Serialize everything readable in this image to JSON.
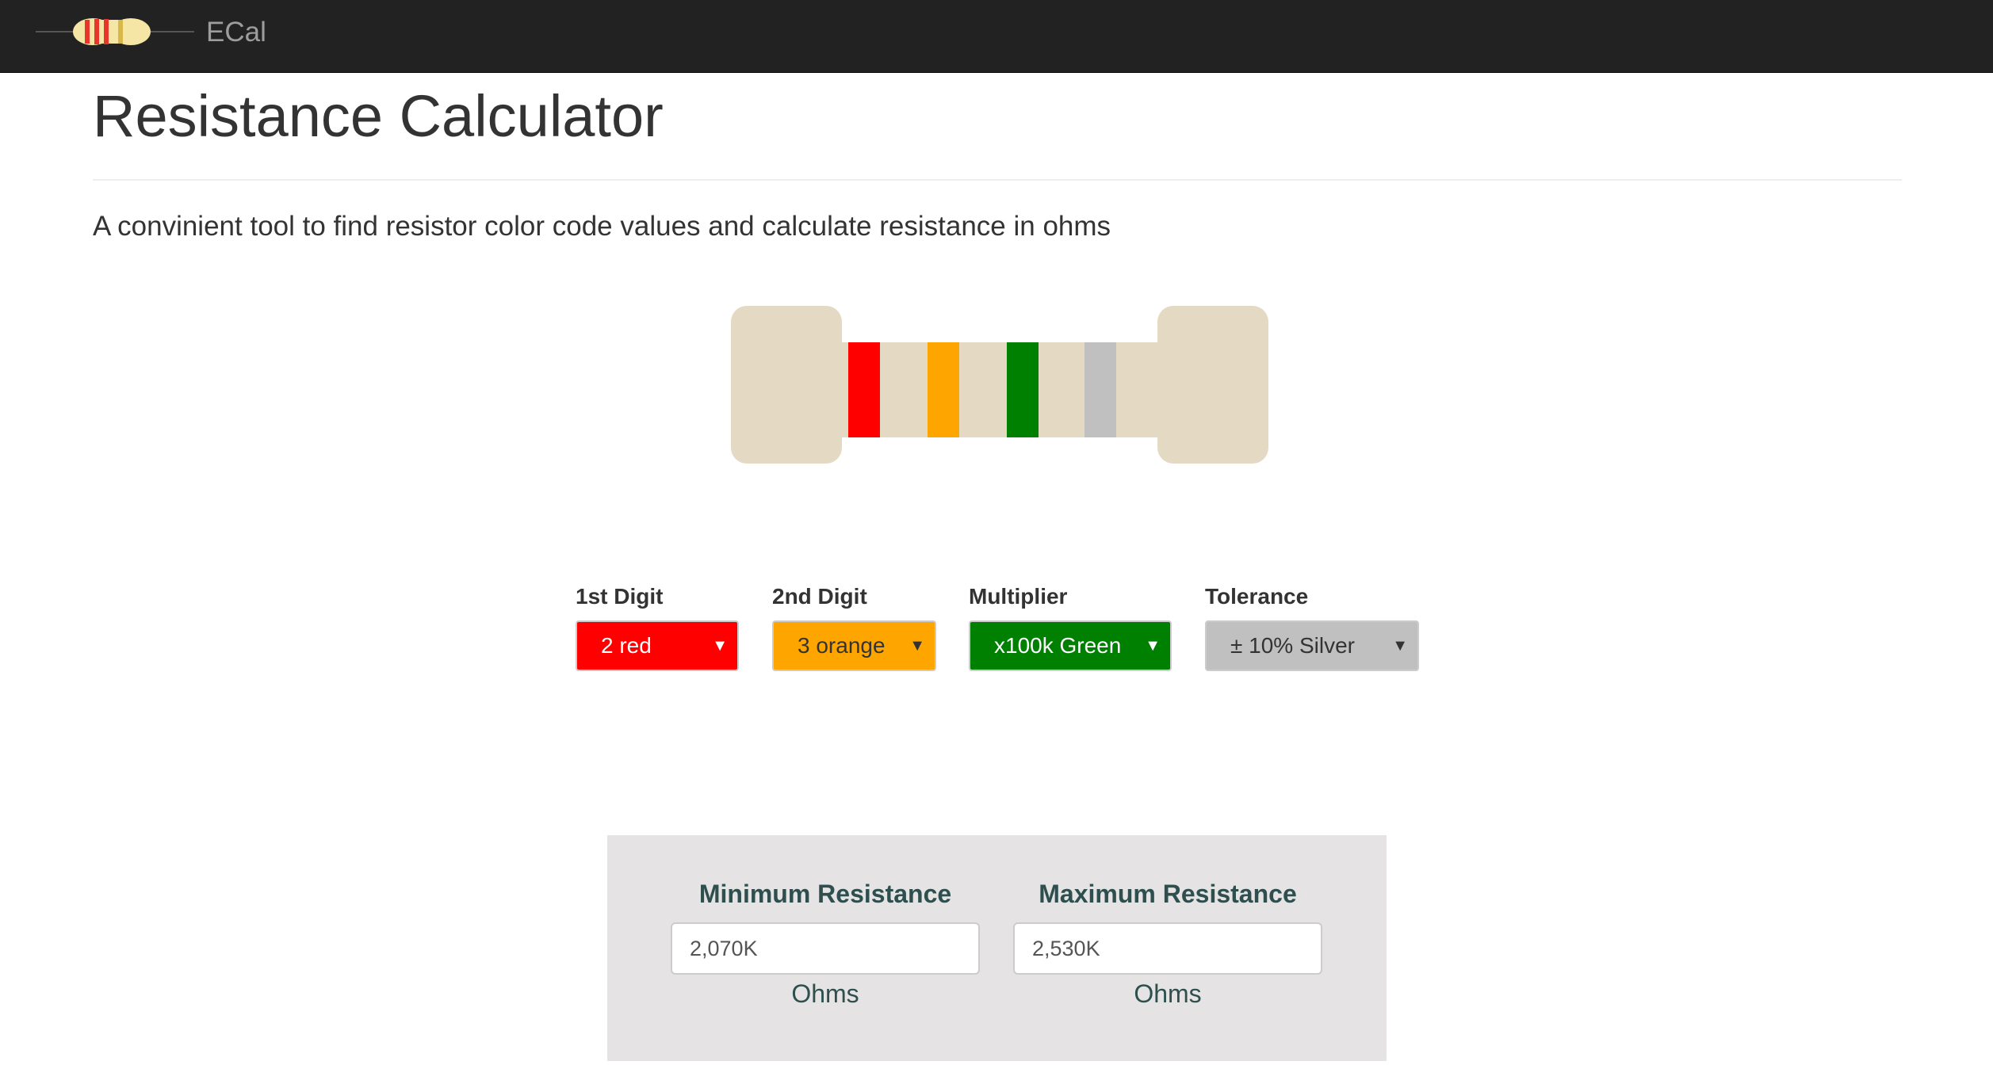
{
  "navbar": {
    "brand": "ECal",
    "logo_icon": "resistor-icon"
  },
  "header": {
    "title": "Resistance Calculator",
    "description": "A convinient tool to find resistor color code values and calculate resistance in ohms"
  },
  "resistor": {
    "body_color": "#e4d9c3",
    "bands": [
      {
        "name": "first-digit",
        "color": "#ff0000"
      },
      {
        "name": "second-digit",
        "color": "#ffa500"
      },
      {
        "name": "multiplier",
        "color": "#008000"
      },
      {
        "name": "tolerance",
        "color": "#c0c0c0"
      }
    ]
  },
  "selectors": [
    {
      "label": "1st Digit",
      "value": "2 red",
      "background": "#ff0000",
      "text_color": "#ffffff"
    },
    {
      "label": "2nd Digit",
      "value": "3 orange",
      "background": "#ffa500",
      "text_color": "#333333"
    },
    {
      "label": "Multiplier",
      "value": "x100k Green",
      "background": "#008000",
      "text_color": "#ffffff"
    },
    {
      "label": "Tolerance",
      "value": "± 10% Silver",
      "background": "#c0c0c0",
      "text_color": "#333333"
    }
  ],
  "results": {
    "min": {
      "heading": "Minimum Resistance",
      "value": "2,070K",
      "unit": "Ohms"
    },
    "max": {
      "heading": "Maximum Resistance",
      "value": "2,530K",
      "unit": "Ohms"
    }
  }
}
